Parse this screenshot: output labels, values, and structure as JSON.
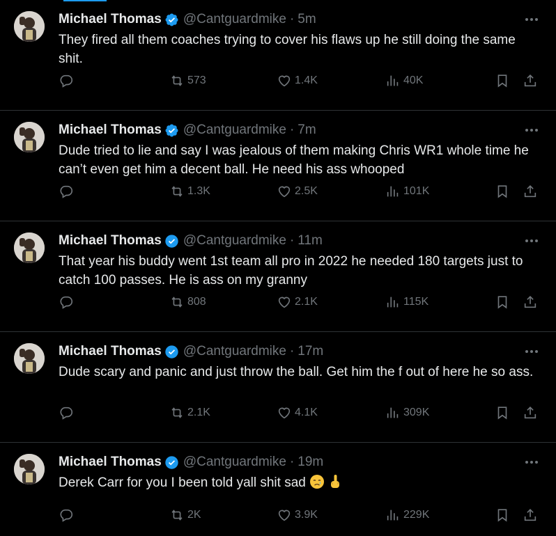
{
  "tweets": [
    {
      "name": "Michael Thomas",
      "handle": "@Cantguardmike",
      "sep": "·",
      "time": "5m",
      "text": "They fired all them coaches trying to cover his flaws up he still doing the same shit.",
      "retweets": "573",
      "likes": "1.4K",
      "views": "40K"
    },
    {
      "name": "Michael Thomas",
      "handle": "@Cantguardmike",
      "sep": "·",
      "time": "7m",
      "text": "Dude tried to lie and say I was jealous of them making Chris WR1 whole time he can’t even get him a decent ball. He need his ass whooped",
      "retweets": "1.3K",
      "likes": "2.5K",
      "views": "101K"
    },
    {
      "name": "Michael Thomas",
      "handle": "@Cantguardmike",
      "sep": "·",
      "time": "11m",
      "text": "That year his buddy went 1st team all pro  in 2022 he needed 180 targets just to catch 100 passes. He is ass on my granny",
      "retweets": "808",
      "likes": "2.1K",
      "views": "115K"
    },
    {
      "name": "Michael Thomas",
      "handle": "@Cantguardmike",
      "sep": "·",
      "time": "17m",
      "text": "Dude scary and panic and just throw the ball. Get him the f out of here he so ass.",
      "retweets": "2.1K",
      "likes": "4.1K",
      "views": "309K"
    },
    {
      "name": "Michael Thomas",
      "handle": "@Cantguardmike",
      "sep": "·",
      "time": "19m",
      "text": "Derek Carr for you I been told yall shit sad",
      "emojis": [
        "crying-face",
        "middle-finger"
      ],
      "retweets": "2K",
      "likes": "3.9K",
      "views": "229K"
    }
  ],
  "icons": {
    "reply": "reply-icon",
    "retweet": "retweet-icon",
    "like": "heart-icon",
    "views": "views-icon",
    "bookmark": "bookmark-icon",
    "share": "share-icon",
    "more": "more-icon",
    "verified": "verified-badge-icon"
  },
  "colors": {
    "background": "#000000",
    "text": "#e7e9ea",
    "secondary": "#71767b",
    "accent": "#1d9bf0",
    "divider": "#2f3336"
  }
}
